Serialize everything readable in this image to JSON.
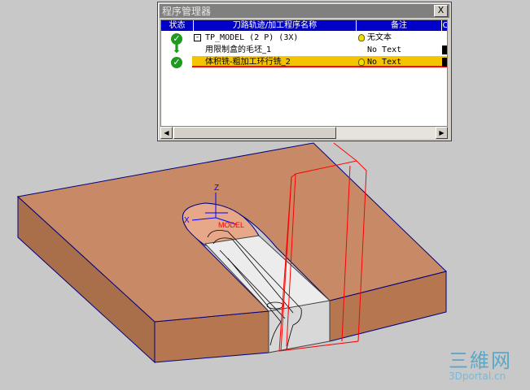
{
  "window": {
    "title": "程序管理器",
    "close_label": "X"
  },
  "table": {
    "columns": [
      "状态",
      "刀路轨迹/加工程序名称",
      "备注",
      "C"
    ],
    "rows": [
      {
        "name": "TP_MODEL (2 P) (3X)",
        "note": "无文本",
        "selected": false
      },
      {
        "name": "用限制盒的毛坯_1",
        "note": "No Text",
        "selected": false
      },
      {
        "name": "体积铣-粗加工环行铣_2",
        "note": "No Text",
        "selected": true
      }
    ]
  },
  "model": {
    "axis_z": "Z",
    "axis_x": "X",
    "origin_label": "MODEL"
  },
  "watermark": {
    "brand": "三維网",
    "site": "3Dportal.cn"
  },
  "colors": {
    "part_top": "#c88a66",
    "part_side": "#b57650",
    "header_blue": "#0000c8",
    "selected_row": "#f5c400",
    "status_green": "#1e9a1e",
    "toolpath": "#ff0000",
    "edges": "#000080"
  },
  "icons": {
    "status": "check-circle-icon",
    "note": "lightbulb-icon",
    "tree": "minus-box-icon"
  }
}
